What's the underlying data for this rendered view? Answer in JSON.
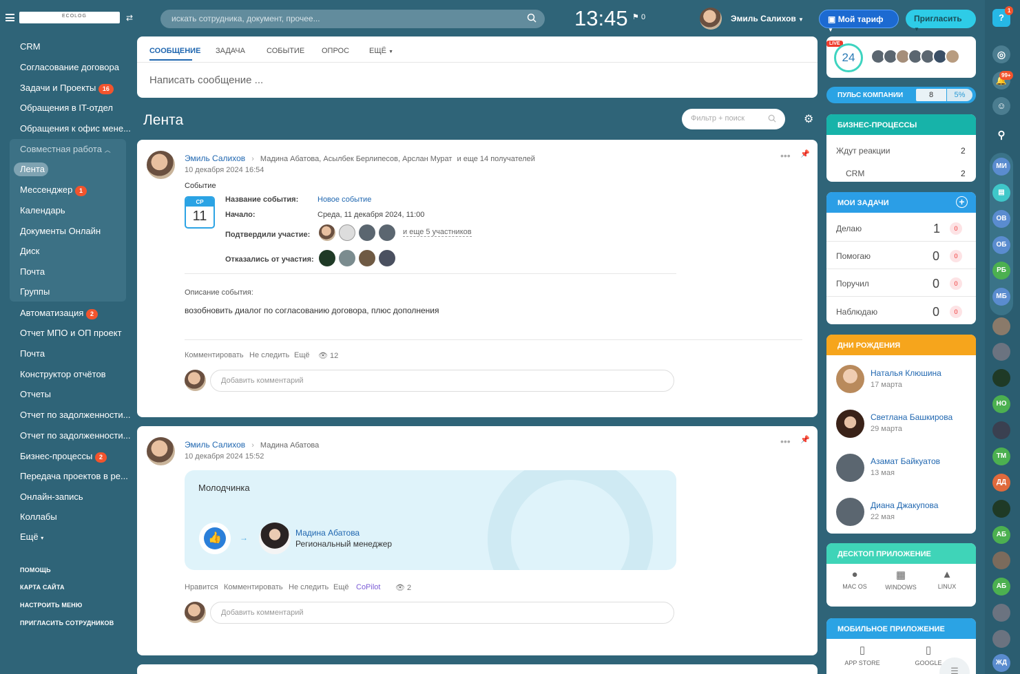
{
  "topbar": {
    "logo_text": "ECOLOG",
    "search_placeholder": "искать сотрудника, документ, прочее...",
    "clock": "13:45",
    "flag_count": "0",
    "user_name": "Эмиль Салихов",
    "tariff_label": "Мой тариф",
    "invite_label": "Пригласить",
    "help_badge": "1"
  },
  "sidebar": {
    "items": [
      {
        "label": "CRM"
      },
      {
        "label": "Согласование договора"
      },
      {
        "label": "Задачи и Проекты",
        "badge": "16"
      },
      {
        "label": "Обращения в IT-отдел"
      },
      {
        "label": "Обращения к офис мене..."
      }
    ],
    "group_label": "Совместная работа",
    "group_items": [
      {
        "label": "Лента"
      },
      {
        "label": "Мессенджер",
        "badge": "1"
      },
      {
        "label": "Календарь"
      },
      {
        "label": "Документы Онлайн"
      },
      {
        "label": "Диск"
      },
      {
        "label": "Почта"
      },
      {
        "label": "Группы"
      }
    ],
    "more_items": [
      {
        "label": "Автоматизация",
        "badge": "2"
      },
      {
        "label": "Отчет МПО и ОП проект"
      },
      {
        "label": "Почта"
      },
      {
        "label": "Конструктор отчётов"
      },
      {
        "label": "Отчеты"
      },
      {
        "label": "Отчет по задолженности..."
      },
      {
        "label": "Отчет по задолженности..."
      },
      {
        "label": "Бизнес-процессы",
        "badge": "2"
      },
      {
        "label": "Передача проектов в ре..."
      },
      {
        "label": "Онлайн-запись"
      },
      {
        "label": "Коллабы"
      },
      {
        "label": "Ещё"
      }
    ],
    "footer_links": [
      "ПОМОЩЬ",
      "КАРТА САЙТА",
      "НАСТРОИТЬ МЕНЮ",
      "ПРИГЛАСИТЬ СОТРУДНИКОВ"
    ]
  },
  "composer": {
    "tabs": [
      "СООБЩЕНИЕ",
      "ЗАДАЧА",
      "СОБЫТИЕ",
      "ОПРОС",
      "ЕЩЁ"
    ],
    "placeholder": "Написать сообщение ..."
  },
  "feed": {
    "title": "Лента",
    "filter_placeholder": "Фильтр + поиск"
  },
  "post1": {
    "author": "Эмиль Салихов",
    "recipients": "Мадина Абатова, Асылбек Берлипесов, Арслан Мурат",
    "recipients_more": "и еще 14 получателей",
    "date": "10 декабря 2024 16:54",
    "type_label": "Событие",
    "cal_day_label": "СР",
    "cal_day": "11",
    "event_name_label": "Название события:",
    "event_name": "Новое событие",
    "start_label": "Начало:",
    "start_value": "Среда, 11 декабря 2024, 11:00",
    "confirmed_label": "Подтвердили участие:",
    "confirmed_more": "и еще 5 участников",
    "declined_label": "Отказались от участия:",
    "desc_label": "Описание события:",
    "desc": "возобновить диалог по согласованию договора, плюс дополнения",
    "actions": [
      "Комментировать",
      "Не следить",
      "Ещё"
    ],
    "views": "12",
    "comment_placeholder": "Добавить комментарий"
  },
  "post2": {
    "author": "Эмиль Салихов",
    "recipient": "Мадина Абатова",
    "date": "10 декабря 2024 15:52",
    "thanks_text": "Молодчинка",
    "person_name": "Мадина Абатова",
    "person_title": "Региональный менеджер",
    "actions": [
      "Нравится",
      "Комментировать",
      "Не следить",
      "Ещё"
    ],
    "copilot": "CoPilot",
    "views": "2",
    "comment_placeholder": "Добавить комментарий"
  },
  "right": {
    "live_label": "LIVE",
    "live_count": "24",
    "pulse_label": "ПУЛЬС КОМПАНИИ",
    "pulse_value": "8",
    "pulse_percent": "5%",
    "bp_title": "БИЗНЕС-ПРОЦЕССЫ",
    "bp_rows": [
      {
        "label": "Ждут реакции",
        "value": "2"
      },
      {
        "label": "CRM",
        "value": "2"
      }
    ],
    "tasks_title": "МОИ ЗАДАЧИ",
    "tasks_rows": [
      {
        "label": "Делаю",
        "value": "1",
        "badge": "0"
      },
      {
        "label": "Помогаю",
        "value": "0",
        "badge": "0"
      },
      {
        "label": "Поручил",
        "value": "0",
        "badge": "0"
      },
      {
        "label": "Наблюдаю",
        "value": "0",
        "badge": "0"
      }
    ],
    "bday_title": "ДНИ РОЖДЕНИЯ",
    "birthdays": [
      {
        "name": "Наталья Клюшина",
        "date": "17 марта"
      },
      {
        "name": "Светлана Башкирова",
        "date": "29 марта"
      },
      {
        "name": "Азамат Байкуатов",
        "date": "13 мая"
      },
      {
        "name": "Диана Джакупова",
        "date": "22 мая"
      }
    ],
    "desktop_title": "ДЕСКТОП ПРИЛОЖЕНИЕ",
    "desktop_apps": [
      "MAC OS",
      "WINDOWS",
      "LINUX"
    ],
    "mobile_title": "МОБИЛЬНОЕ ПРИЛОЖЕНИЕ",
    "mobile_apps": [
      "APP STORE",
      "GOOGLE"
    ]
  },
  "rail": {
    "notif_badge": "99+",
    "initials": [
      "МИ",
      "ОВ",
      "ОБ",
      "РБ",
      "МБ",
      "НО",
      "ТМ",
      "ДД",
      "АБ",
      "АБ",
      "ЖД"
    ]
  },
  "colors": {
    "background": "#2f6478",
    "accent_blue": "#2067b0",
    "panel_teal": "#17b3a9",
    "panel_blue": "#2b9ee6",
    "panel_orange": "#f6a51c",
    "panel_green": "#3fd4b8",
    "badge_red": "#f2542d"
  }
}
